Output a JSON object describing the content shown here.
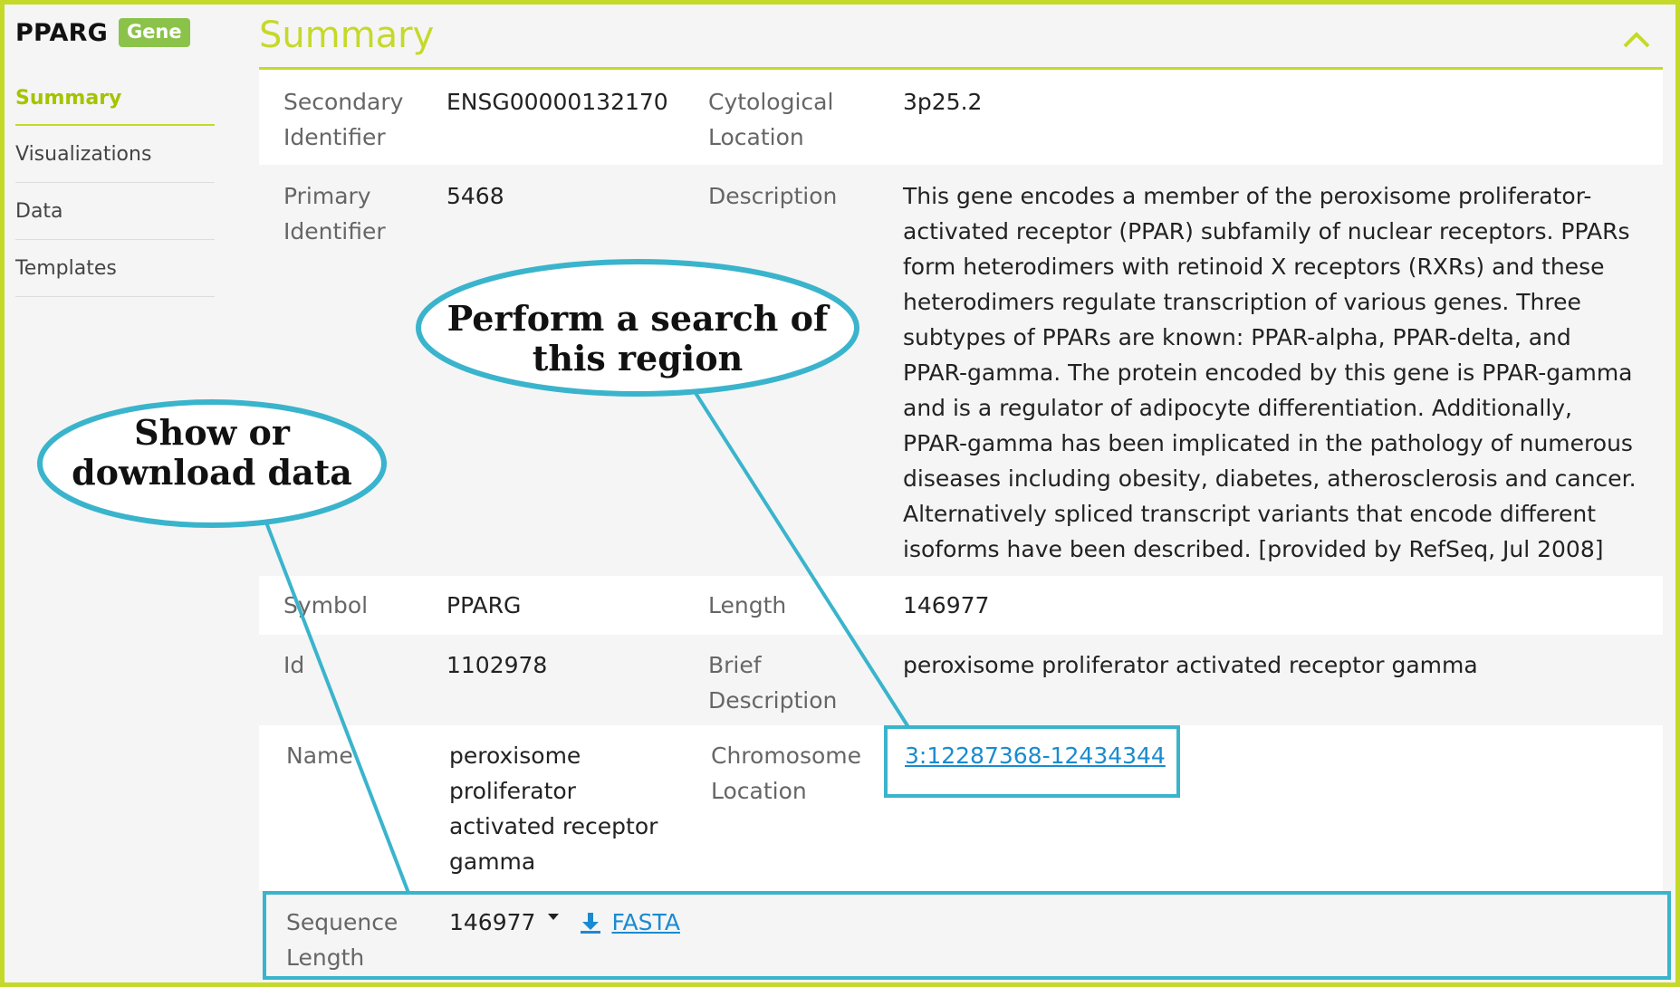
{
  "gene": {
    "symbol": "PPARG",
    "badge": "Gene"
  },
  "sidebar": {
    "items": [
      {
        "label": "Summary",
        "active": true
      },
      {
        "label": "Visualizations",
        "active": false
      },
      {
        "label": "Data",
        "active": false
      },
      {
        "label": "Templates",
        "active": false
      }
    ]
  },
  "section": {
    "title": "Summary",
    "collapse_icon": "chevron-up-icon"
  },
  "fields": {
    "secondary_identifier": {
      "label": "Secondary Identifier",
      "value": "ENSG00000132170"
    },
    "cytological_location": {
      "label": "Cytological Location",
      "value": "3p25.2"
    },
    "primary_identifier": {
      "label": "Primary Identifier",
      "value": "5468"
    },
    "description": {
      "label": "Description",
      "value": "This gene encodes a member of the peroxisome proliferator-activated receptor (PPAR) subfamily of nuclear receptors. PPARs form heterodimers with retinoid X receptors (RXRs) and these heterodimers regulate transcription of various genes. Three subtypes of PPARs are known: PPAR-alpha, PPAR-delta, and PPAR-gamma. The protein encoded by this gene is PPAR-gamma and is a regulator of adipocyte differentiation. Additionally, PPAR-gamma has been implicated in the pathology of numerous diseases including obesity, diabetes, atherosclerosis and cancer. Alternatively spliced transcript variants that encode different isoforms have been described. [provided by RefSeq, Jul 2008]"
    },
    "symbol": {
      "label": "Symbol",
      "value": "PPARG"
    },
    "length": {
      "label": "Length",
      "value": "146977"
    },
    "id": {
      "label": "Id",
      "value": "1102978"
    },
    "brief_description": {
      "label": "Brief Description",
      "value": "peroxisome proliferator activated receptor gamma"
    },
    "name": {
      "label": "Name",
      "value": "peroxisome proliferator activated receptor gamma"
    },
    "chromosome_location": {
      "label": "Chromosome Location",
      "value": "3:12287368-12434344"
    },
    "sequence_length": {
      "label": "Sequence Length",
      "value": "146977",
      "download_label": "FASTA",
      "download_icon": "download-icon"
    }
  },
  "annotations": {
    "search_region": "Perform a search of\nthis region",
    "show_download": "Show or\ndownload data",
    "color": "#3ab4cc"
  },
  "colors": {
    "accent": "#c5d92a",
    "badge": "#8bc34a",
    "link": "#1a8bd0"
  }
}
